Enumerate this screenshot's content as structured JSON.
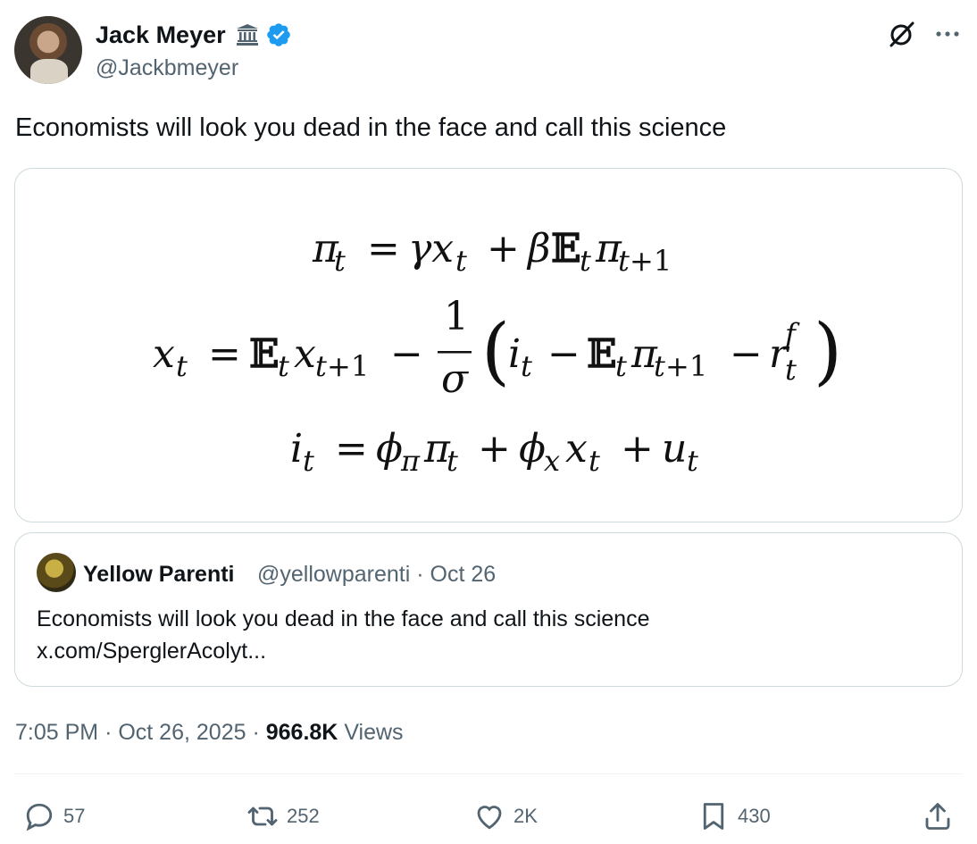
{
  "author": {
    "name": "Jack Meyer",
    "handle": "@Jackbmeyer",
    "badges": [
      "government-building-icon",
      "verified-badge-icon"
    ]
  },
  "header_icons": [
    "grok-icon",
    "more-icon"
  ],
  "tweet": {
    "text": "Economists will look you dead in the face and call this science",
    "media": {
      "type": "equation-image",
      "equations": [
        "π_t = γx_t + βE_t π_{t+1}",
        "x_t = E_t x_{t+1} − (1/σ)(i_t − E_t π_{t+1} − r_t^f)",
        "i_t = φ_π π_t + φ_x x_t + u_t"
      ]
    }
  },
  "quote": {
    "name": "Yellow Parenti",
    "handle": "@yellowparenti",
    "date": "Oct 26",
    "meta": "@yellowparenti · Oct 26",
    "text": "Economists will look you dead in the face and call this science",
    "link": "x.com/SperglerAcolyt..."
  },
  "meta": {
    "time": "7:05 PM",
    "date": "Oct 26, 2025",
    "views_count": "966.8K",
    "views_label": "Views"
  },
  "actions": {
    "replies": "57",
    "reposts": "252",
    "likes": "2K",
    "bookmarks": "430"
  },
  "colors": {
    "text": "#0f1419",
    "secondary": "#536471",
    "verified": "#1d9bf0",
    "border": "#cfd9de"
  }
}
